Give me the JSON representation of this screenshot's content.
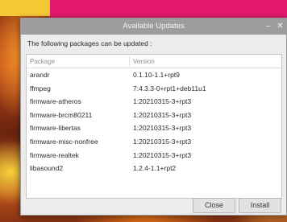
{
  "dialog": {
    "title": "Available Updates",
    "minimize_label": "–",
    "close_label": "✕",
    "info_text": "The following packages can be updated :"
  },
  "list": {
    "columns": [
      "Package",
      "Version"
    ],
    "rows": [
      {
        "package": "arandr",
        "version": "0.1.10-1.1+rpt9"
      },
      {
        "package": "ffmpeg",
        "version": "7:4.3.3-0+rpt1+deb11u1"
      },
      {
        "package": "firmware-atheros",
        "version": "1:20210315-3+rpt3"
      },
      {
        "package": "firmware-brcm80211",
        "version": "1:20210315-3+rpt3"
      },
      {
        "package": "firmware-libertas",
        "version": "1:20210315-3+rpt3"
      },
      {
        "package": "firmware-misc-nonfree",
        "version": "1:20210315-3+rpt3"
      },
      {
        "package": "firmware-realtek",
        "version": "1:20210315-3+rpt3"
      },
      {
        "package": "libasound2",
        "version": "1.2.4-1.1+rpt2"
      }
    ]
  },
  "buttons": {
    "close_label": "Close",
    "install_label": "Install"
  },
  "colors": {
    "banner_pink": "#e5186f",
    "banner_yellow": "#f7c836",
    "titlebar": "#9d9d9d",
    "dialog_bg": "#ececec"
  }
}
